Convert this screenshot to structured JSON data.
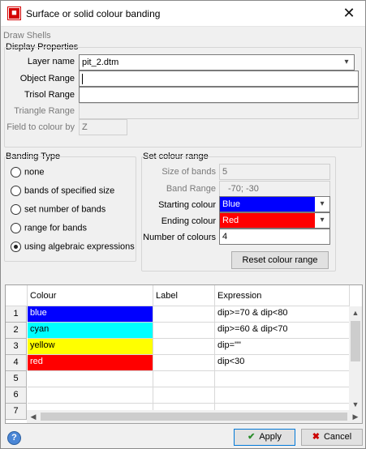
{
  "window": {
    "title": "Surface or solid colour banding",
    "close_glyph": "✕",
    "app_icon": "app-icon"
  },
  "draw_shells_label": "Draw Shells",
  "display_properties": {
    "title": "Display Properties",
    "layer_name_label": "Layer name",
    "layer_name_value": "pit_2.dtm",
    "object_range_label": "Object Range",
    "object_range_value": "",
    "trisol_range_label": "Trisol Range",
    "trisol_range_value": "",
    "triangle_range_label": "Triangle Range",
    "triangle_range_value": "",
    "field_to_colour_label": "Field to colour by",
    "field_to_colour_value": "Z"
  },
  "banding_type": {
    "title": "Banding Type",
    "options": [
      {
        "label": "none",
        "selected": false
      },
      {
        "label": "bands of specified size",
        "selected": false
      },
      {
        "label": "set number of bands",
        "selected": false
      },
      {
        "label": "range for bands",
        "selected": false
      },
      {
        "label": "using algebraic expressions",
        "selected": true
      }
    ]
  },
  "colour_range": {
    "title": "Set colour range",
    "size_label": "Size of bands",
    "size_value": "5",
    "band_range_label": "Band Range",
    "band_range_value": "-70;  -30",
    "starting_label": "Starting colour",
    "starting_value": "Blue",
    "starting_color": "#0000ff",
    "ending_label": "Ending colour",
    "ending_value": "Red",
    "ending_color": "#ff0000",
    "number_label": "Number of colours",
    "number_value": "4",
    "reset_button": "Reset colour range"
  },
  "grid": {
    "columns": [
      "Colour",
      "Label",
      "Expression"
    ],
    "rows": [
      {
        "num": "1",
        "colour": "blue",
        "color_hex": "#0000ff",
        "text_color": "#ffffff",
        "label": "",
        "expression": "dip>=70 & dip<80"
      },
      {
        "num": "2",
        "colour": "cyan",
        "color_hex": "#00ffff",
        "text_color": "#000000",
        "label": "",
        "expression": "dip>=60 & dip<70"
      },
      {
        "num": "3",
        "colour": "yellow",
        "color_hex": "#ffff00",
        "text_color": "#000000",
        "label": "",
        "expression": "dip=\"\""
      },
      {
        "num": "4",
        "colour": "red",
        "color_hex": "#ff0000",
        "text_color": "#ffffff",
        "label": "",
        "expression": "dip<30"
      },
      {
        "num": "5",
        "colour": "",
        "color_hex": "",
        "text_color": "",
        "label": "",
        "expression": ""
      },
      {
        "num": "6",
        "colour": "",
        "color_hex": "",
        "text_color": "",
        "label": "",
        "expression": ""
      },
      {
        "num": "7",
        "colour": "",
        "color_hex": "",
        "text_color": "",
        "label": "",
        "expression": ""
      }
    ]
  },
  "footer": {
    "help_glyph": "?",
    "apply_label": "Apply",
    "cancel_label": "Cancel"
  }
}
